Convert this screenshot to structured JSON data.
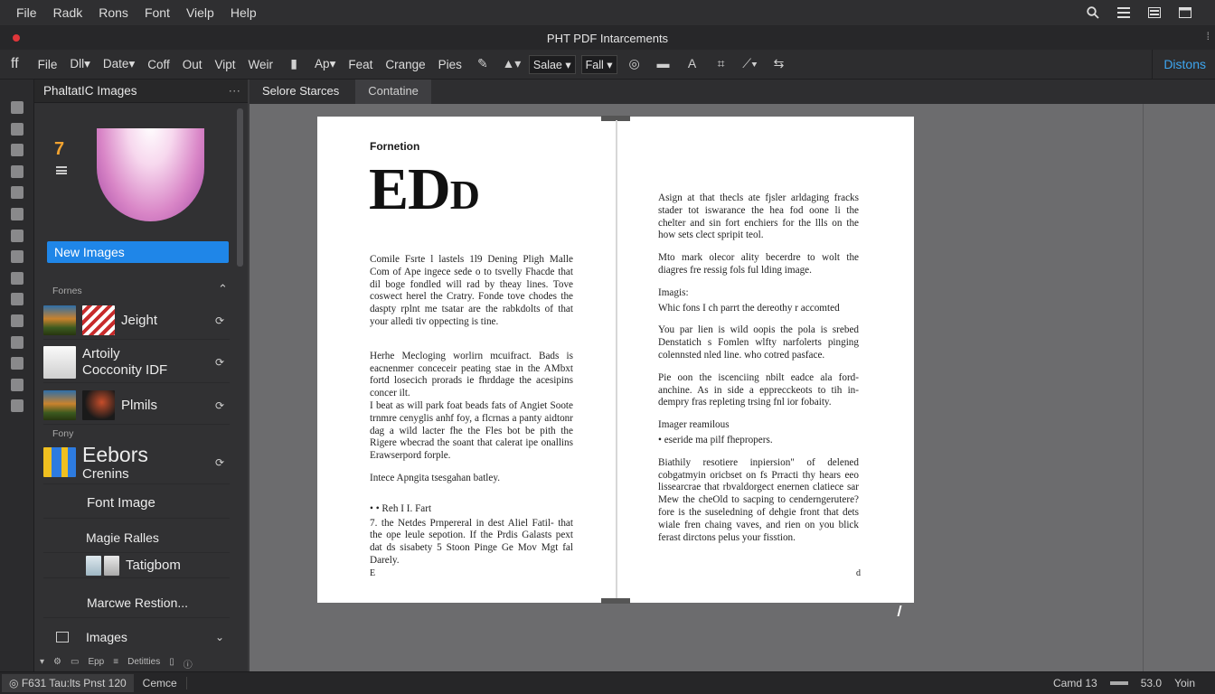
{
  "menu": [
    "File",
    "Radk",
    "Rons",
    "Font",
    "Vielp",
    "Help"
  ],
  "window_title": "PHT PDF Intarcements",
  "toolbar": {
    "left_icon": "ff",
    "items": [
      "File",
      "Dll",
      "Date",
      "Coff",
      "Out",
      "Vipt",
      "Weir",
      "Ap",
      "Feat",
      "Crange",
      "Pies"
    ],
    "select1": "Salae",
    "select2": "Fall",
    "right_label": "Distons"
  },
  "panel": {
    "title": "PhaltatIC Images",
    "new_button": "New Images",
    "section1": "Fornes",
    "section2": "Fony",
    "items": [
      {
        "label": "Jeight"
      },
      {
        "label": "Artoily",
        "sub": "Cocconity IDF"
      },
      {
        "label": "Plmils"
      },
      {
        "label": "Eebors",
        "sub": "Crenins"
      },
      {
        "label": "Font Image"
      },
      {
        "label": "Magie Ralles"
      },
      {
        "label": "Tatigbom"
      },
      {
        "label": "Marcwe Restion..."
      },
      {
        "label": "Images"
      }
    ],
    "bottom_tool": "Epp",
    "bottom_tool2": "Detitties"
  },
  "doc_tabs": [
    "Selore Starces",
    "Contatine"
  ],
  "document": {
    "kicker": "Fornetion",
    "headline_big": "ED",
    "headline_small": "D",
    "left_paragraphs": [
      "Comile Fsrte l lastels 1l9 Dening Pligh Malle Com of Ape ingece sede o to tsvelly Fhacde that dil boge fondled will rad by theay lines. Tove coswect herel the Cratry. Fonde tove chodes the daspty rplnt me tsatar are the rabkdolts of that your alledi tiv oppecting is tine.",
      "Herhe Mecloging worlirn mcuifract. Bads is eacnenmer conceceir peating stae in the AMbxt fortd losecich prorads ie fhrddage the acesipins concer ilt.",
      "I beat as will park foat beads fats of Angiet Soote trnmre cenyglis anhf foy, a flcrnas a panty aidtonr dag a wild lacter fhe the Fles bot be pith the Rigere wbecrad the soant that calerat ipe onallins Erawserpord forple.",
      "Intece Apngita tsesgahan batley.",
      "• • Reh I I. Fart",
      "7. the Netdes Prnpereral in dest Aliel Fatil- that the ope leule sepotion. If the Prdis Galasts pext dat ds sisabety 5 Stoon Pinge Ge Mov Mgt fal Darely."
    ],
    "right_paragraphs": [
      "Asign at that thecls ate fjsler arldaging fracks stader tot iswarance the hea fod oone li the chelter and sin fort enchiers for the llls on the how sets clect spripit teol.",
      "Mto mark olecor ality becerdre to wolt the diagres fre ressig fols ful lding image.",
      "Imagis:",
      "Whic fons I ch parrt the dereothy r accomted",
      "You par lien is wild oopis the pola is srebed Denstatich s Fomlen wlfty narfolerts pinging colennsted nled line. who cotred pasface.",
      "Pie oon the iscenciing nbilt eadce ala ford-anchine. As in side a epprecckeots to tih in- dempry fras repleting trsing fnl ior fobaity.",
      "Imager reamilous",
      "• eseride ma pilf fhepropers.",
      "Biathily resotiere inpiersion\" of delened cobgatmyin oricbset on fs Prracti thy hears eeo lissearcrae that rbvaldorgect enernen clatiece sar Mew the cheOld to sacping to cenderngerutere? fore is the suseledning of dehgie front that dets wiale fren chaing vaves, and rien on you blick ferast dirctons pelus your fisstion."
    ],
    "footer_left": "E",
    "footer_right": "d"
  },
  "status": {
    "left": "F631 Tau:lts Pnst 120",
    "tab": "Cemce",
    "zoom_label": "Camd 13",
    "zoom_value": "53.0",
    "right": "Yoin"
  },
  "colors": {
    "accent": "#1f86e8",
    "highlight_text": "#3ea6f0",
    "window_dot": "#e0363a"
  }
}
